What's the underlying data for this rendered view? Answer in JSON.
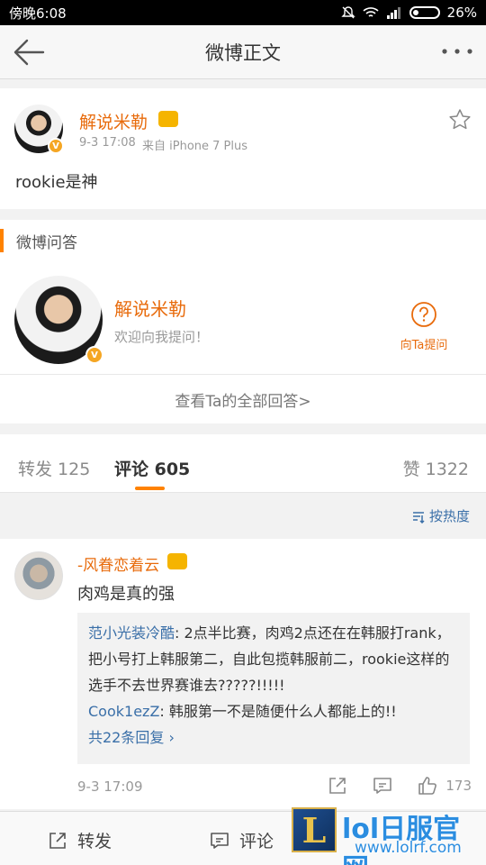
{
  "status": {
    "left": "傍晚6:08",
    "battery": "26%"
  },
  "nav": {
    "title": "微博正文"
  },
  "post": {
    "author": "解说米勒",
    "time": "9-3 17:08",
    "source": "来自 iPhone 7 Plus",
    "text": "rookie是神"
  },
  "qa": {
    "title": "微博问答",
    "name": "解说米勒",
    "subtitle": "欢迎向我提问！",
    "ask_label": "向Ta提问",
    "view_all": "查看Ta的全部回答>"
  },
  "tabs": {
    "repost": "转发 125",
    "comment": "评论 605",
    "like": "赞 1322"
  },
  "sort_label": "按热度",
  "comment": {
    "author": "-风眷恋着云",
    "text": "肉鸡是真的强",
    "replies": [
      {
        "name": "范小光装冷酷",
        "text": ": 2点半比赛，肉鸡2点还在在韩服打rank，把小号打上韩服第二，自此包揽韩服前二，rookie这样的选手不去世界赛谁去?????!!!!!"
      },
      {
        "name": "Cook1ezZ",
        "text": ": 韩服第一不是随便什么人都能上的!!"
      }
    ],
    "more_replies": "共22条回复",
    "time": "9-3 17:09",
    "likes": "173"
  },
  "bottom": {
    "repost": "转发",
    "comment": "评论"
  },
  "watermark": {
    "title": "lol日服官网",
    "url": "www.lolrf.com",
    "logo": "L"
  }
}
